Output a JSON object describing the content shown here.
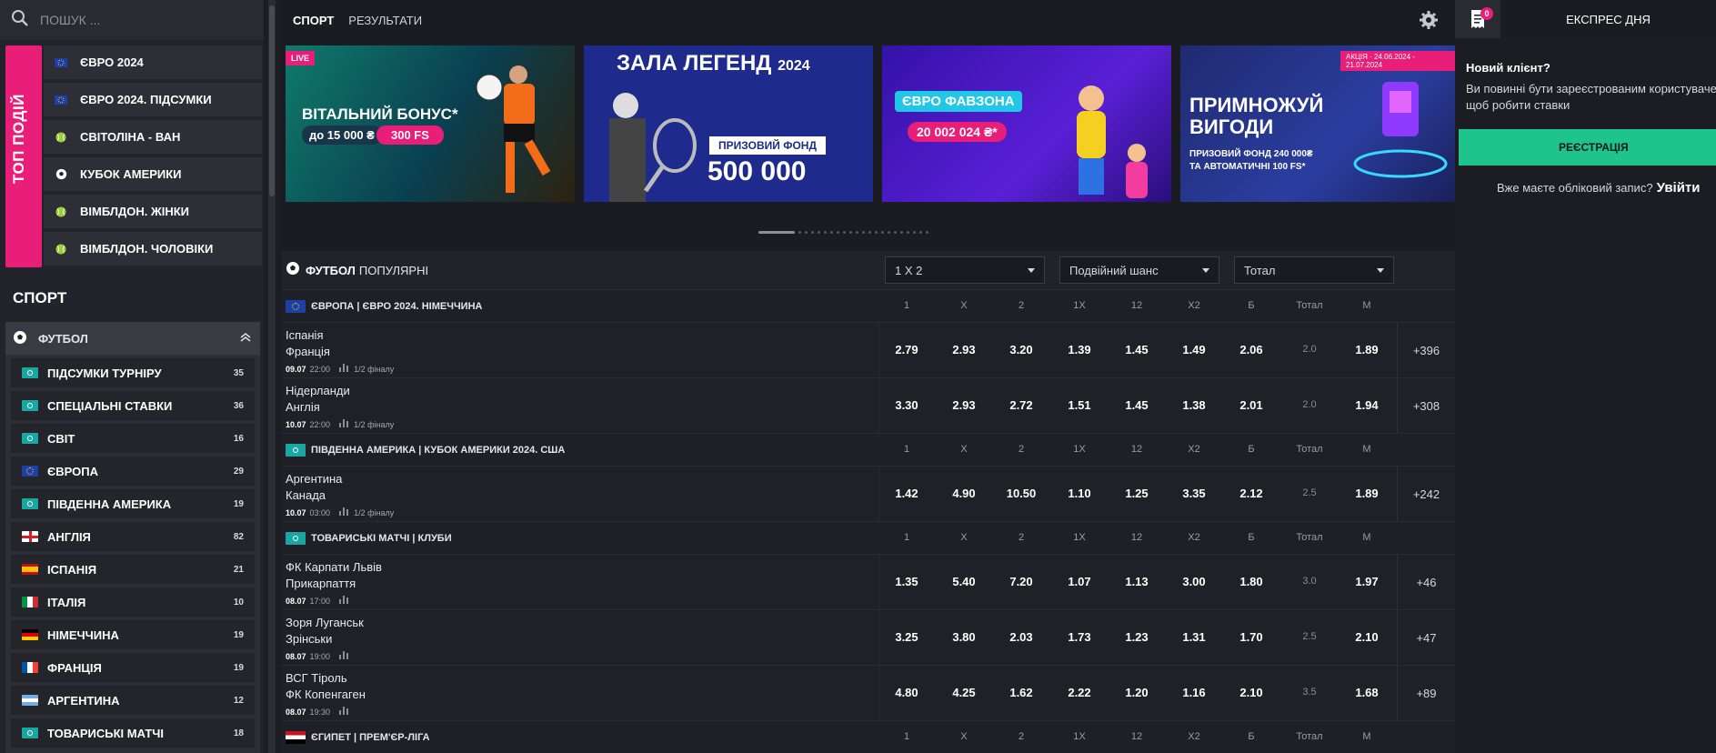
{
  "search": {
    "placeholder": "ПОШУК ..."
  },
  "top_events": {
    "title": "ТОП ПОДІЙ",
    "items": [
      {
        "label": "ЄВРО 2024",
        "icon": "euro-flag-icon"
      },
      {
        "label": "ЄВРО 2024. ПІДСУМКИ",
        "icon": "euro-flag-icon"
      },
      {
        "label": "СВІТОЛІНА - ВАН",
        "icon": "tennis-ball-icon"
      },
      {
        "label": "КУБОК АМЕРИКИ",
        "icon": "soccer-ball-icon"
      },
      {
        "label": "ВІМБЛДОН. ЖІНКИ",
        "icon": "tennis-ball-icon"
      },
      {
        "label": "ВІМБЛДОН. ЧОЛОВІКИ",
        "icon": "tennis-ball-icon"
      }
    ]
  },
  "sport": {
    "heading": "СПОРТ",
    "current": "ФУТБОЛ",
    "items": [
      {
        "label": "ПІДСУМКИ ТУРНІРУ",
        "count": "35",
        "flag": "world"
      },
      {
        "label": "СПЕЦІАЛЬНІ СТАВКИ",
        "count": "36",
        "flag": "world"
      },
      {
        "label": "СВІТ",
        "count": "16",
        "flag": "world"
      },
      {
        "label": "ЄВРОПА",
        "count": "29",
        "flag": "eu"
      },
      {
        "label": "ПІВДЕННА АМЕРИКА",
        "count": "19",
        "flag": "world"
      },
      {
        "label": "АНГЛІЯ",
        "count": "82",
        "flag": "england"
      },
      {
        "label": "ІСПАНІЯ",
        "count": "21",
        "flag": "spain"
      },
      {
        "label": "ІТАЛІЯ",
        "count": "10",
        "flag": "italy"
      },
      {
        "label": "НІМЕЧЧИНА",
        "count": "19",
        "flag": "germany"
      },
      {
        "label": "ФРАНЦІЯ",
        "count": "19",
        "flag": "france"
      },
      {
        "label": "АРГЕНТИНА",
        "count": "12",
        "flag": "argentina"
      },
      {
        "label": "ТОВАРИСЬКІ МАТЧІ",
        "count": "18",
        "flag": "world"
      }
    ]
  },
  "topnav": {
    "tabs": [
      "СПОРТ",
      "РЕЗУЛЬТАТИ"
    ]
  },
  "banners": [
    {
      "tag": "LIVE",
      "line1": "ВІТАЛЬНИЙ БОНУС*",
      "line2a": "до 15 000 ₴",
      "line2b": "300 FS"
    },
    {
      "line1": "ЗАЛА ЛЕГЕНД",
      "line1b": "2024",
      "line2": "ПРИЗОВИЙ ФОНД",
      "line3": "500 000"
    },
    {
      "line1": "ЄВРО ФАВЗОНА",
      "line2": "20 002 024 ₴*"
    },
    {
      "tag": "АКЦІЯ · 24.06.2024 - 21.07.2024",
      "line1": "ПРИМНОЖУЙ",
      "line1b": "ВИГОДИ",
      "line2": "ПРИЗОВИЙ ФОНД 240 000₴",
      "line3": "ТА АВТОМАТИЧНІ 100 FS*"
    }
  ],
  "table": {
    "sport": "ФУТБОЛ",
    "sub": "ПОПУЛЯРНІ",
    "selects": [
      "1 X 2",
      "Подвійний шанс",
      "Тотал"
    ],
    "headers": [
      "1",
      "X",
      "2",
      "1X",
      "12",
      "X2",
      "Б",
      "Тотал",
      "М"
    ],
    "leagues": [
      {
        "name": "ЄВРОПА | ЄВРО 2024. НІМЕЧЧИНА",
        "flag": "eu",
        "events": [
          {
            "t1": "Іспанія",
            "t2": "Франція",
            "date": "09.07",
            "time": "22:00",
            "stage": "1/2 фіналу",
            "odds": [
              "2.79",
              "2.93",
              "3.20",
              "1.39",
              "1.45",
              "1.49",
              "2.06",
              "2.0",
              "1.89"
            ],
            "more": "+396"
          },
          {
            "t1": "Нідерланди",
            "t2": "Англія",
            "date": "10.07",
            "time": "22:00",
            "stage": "1/2 фіналу",
            "odds": [
              "3.30",
              "2.93",
              "2.72",
              "1.51",
              "1.45",
              "1.38",
              "2.01",
              "2.0",
              "1.94"
            ],
            "more": "+308"
          }
        ]
      },
      {
        "name": "ПІВДЕННА АМЕРИКА | КУБОК АМЕРИКИ 2024. США",
        "flag": "world",
        "events": [
          {
            "t1": "Аргентина",
            "t2": "Канада",
            "date": "10.07",
            "time": "03:00",
            "stage": "1/2 фіналу",
            "odds": [
              "1.42",
              "4.90",
              "10.50",
              "1.10",
              "1.25",
              "3.35",
              "2.12",
              "2.5",
              "1.89"
            ],
            "more": "+242"
          }
        ]
      },
      {
        "name": "ТОВАРИСЬКІ МАТЧІ | КЛУБИ",
        "flag": "world",
        "events": [
          {
            "t1": "ФК Карпати Львів",
            "t2": "Прикарпаття",
            "date": "08.07",
            "time": "17:00",
            "stage": "",
            "odds": [
              "1.35",
              "5.40",
              "7.20",
              "1.07",
              "1.13",
              "3.00",
              "1.80",
              "3.0",
              "1.97"
            ],
            "more": "+46"
          },
          {
            "t1": "Зоря Луганськ",
            "t2": "Зрінськи",
            "date": "08.07",
            "time": "19:00",
            "stage": "",
            "odds": [
              "3.25",
              "3.80",
              "2.03",
              "1.73",
              "1.23",
              "1.31",
              "1.70",
              "2.5",
              "2.10"
            ],
            "more": "+47"
          },
          {
            "t1": "ВСГ Тіроль",
            "t2": "ФК Копенгаген",
            "date": "08.07",
            "time": "19:30",
            "stage": "",
            "odds": [
              "4.80",
              "4.25",
              "1.62",
              "2.22",
              "1.20",
              "1.16",
              "2.10",
              "3.5",
              "1.68"
            ],
            "more": "+89"
          }
        ]
      },
      {
        "name": "ЄГИПЕТ | ПРЕМ'ЄР-ЛІГА",
        "flag": "egypt",
        "events": []
      }
    ]
  },
  "right": {
    "badge": "0",
    "express": "ЕКСПРЕС ДНЯ",
    "new_client": "Новий клієнт?",
    "message": "Ви повинні бути зареєстрованим користувачем щоб робити ставки",
    "register": "РЕЄСТРАЦІЯ",
    "have_account": "Вже маєте обліковий запис?",
    "login": "Увійти"
  },
  "colors": {
    "accent": "#e91e78",
    "register": "#1fc38c",
    "background": "#1b1c22"
  }
}
